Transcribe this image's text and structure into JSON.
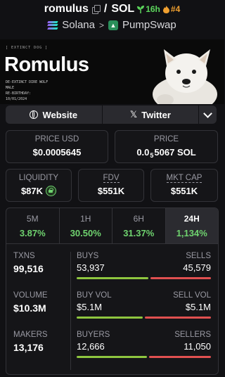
{
  "header": {
    "token": "romulus",
    "quote": "SOL",
    "separator": "/",
    "age": "16h",
    "rank": "#4",
    "chain": "Solana",
    "dex": "PumpSwap",
    "chevron": ">"
  },
  "banner": {
    "tag": "[ EXTINCT DOG ]",
    "title": "Romulus",
    "subtitle": "DE-EXTINCT DIRE WOLF\nMALE\nRE-BIRTHDAY:\n10/01/2024"
  },
  "links": {
    "website": "Website",
    "twitter": "Twitter",
    "x_glyph": "𝕏"
  },
  "price": {
    "usd_label": "PRICE USD",
    "usd_value": "$0.0005645",
    "native_label": "PRICE",
    "native_prefix": "0.0",
    "native_zeros": "5",
    "native_rest": "5067 SOL"
  },
  "market": {
    "liquidity_label": "LIQUIDITY",
    "liquidity_value": "$87K",
    "fdv_label": "FDV",
    "fdv_value": "$551K",
    "mcap_label": "MKT CAP",
    "mcap_value": "$551K"
  },
  "tabs": [
    {
      "label": "5M",
      "value": "3.87%"
    },
    {
      "label": "1H",
      "value": "30.50%"
    },
    {
      "label": "6H",
      "value": "31.37%"
    },
    {
      "label": "24H",
      "value": "1,134%"
    }
  ],
  "stats": {
    "txns_label": "TXNS",
    "txns_value": "99,516",
    "volume_label": "VOLUME",
    "volume_value": "$10.3M",
    "makers_label": "MAKERS",
    "makers_value": "13,176",
    "buys_label": "BUYS",
    "buys_value": "53,937",
    "sells_label": "SELLS",
    "sells_value": "45,579",
    "buys_share": 0.542,
    "buyvol_label": "BUY VOL",
    "buyvol_value": "$5.1M",
    "sellvol_label": "SELL VOL",
    "sellvol_value": "$5.1M",
    "buyvol_share": 0.5,
    "buyers_label": "BUYERS",
    "buyers_value": "12,666",
    "sellers_label": "SELLERS",
    "sellers_value": "11,050",
    "buyers_share": 0.534
  },
  "colors": {
    "positive": "#6fd36f",
    "buy_bar": "#8ec63f",
    "sell_bar": "#e05050",
    "age": "#5cd65c",
    "rank": "#f0a030"
  }
}
